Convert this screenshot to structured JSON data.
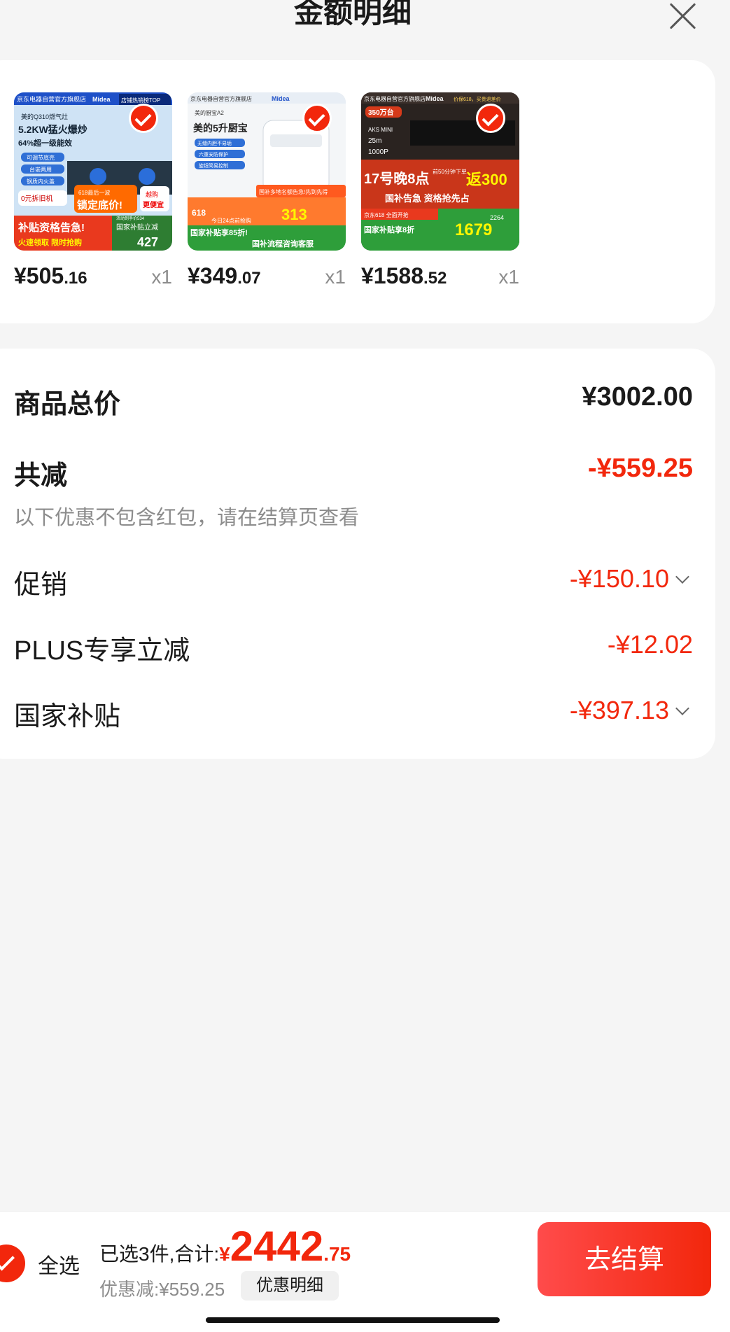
{
  "header": {
    "title": "金额明细",
    "close_icon": "close-icon"
  },
  "products": [
    {
      "price_int": "¥505",
      "price_dec": ".16",
      "qty": "x1",
      "image_texts": [
        "京东电器自营官方旗舰店",
        "Midea",
        "店铺热销榜TOP",
        "美的Q310燃气灶",
        "5.2KW猛火爆炒",
        "64%超一级能效",
        "可调节底壳",
        "台嵌两用",
        "钢质内火盖",
        "0元拆旧机",
        "618最后一波",
        "锁定底价!",
        "越购",
        "更便宜",
        "补贴资格告急!",
        "火速领取 限时抢购",
        "国家补贴立减",
        "427",
        "活动到手价534"
      ]
    },
    {
      "price_int": "¥349",
      "price_dec": ".07",
      "qty": "x1",
      "image_texts": [
        "京东电器自营官方旗舰店",
        "Midea",
        "美的厨宝A2",
        "美的5升厨宝",
        "无缝内胆不易垢",
        "六重安防保护",
        "旋钮简易控制",
        "国补多地名额告急!先到先得",
        "618",
        "今日24点前抢购",
        "313",
        "国家补贴享85折!",
        "国补流程咨询客服"
      ]
    },
    {
      "price_int": "¥1588",
      "price_dec": ".52",
      "qty": "x1",
      "image_texts": [
        "京东电器自营官方旗舰店",
        "Midea",
        "价保618，买贵退差价",
        "350万台",
        "AKS MINI",
        "25m",
        "1000P",
        "17号晚8点",
        "前50分钟下单",
        "返300",
        "国补告急 资格抢先占",
        "京东618 全面开抢",
        "国家补贴享8折",
        "1679",
        "2264"
      ]
    }
  ],
  "amount": {
    "total_label": "商品总价",
    "total_value": "¥3002.00",
    "reduce_label": "共减",
    "reduce_value": "-¥559.25",
    "note": "以下优惠不包含红包，请在结算页查看",
    "rows": [
      {
        "label": "促销",
        "value": "-¥150.10",
        "expandable": true
      },
      {
        "label": "PLUS专享立减",
        "value": "-¥12.02",
        "expandable": false
      },
      {
        "label": "国家补贴",
        "value": "-¥397.13",
        "expandable": true
      }
    ]
  },
  "bottom": {
    "select_all": "全选",
    "summary_prefix": "已选3件,合计:",
    "total_symbol": "¥",
    "total_int": "2442",
    "total_dec": ".75",
    "discount_text": "优惠减:¥559.25",
    "discount_detail_button": "优惠明细",
    "checkout_button": "去结算"
  },
  "colors": {
    "accent_red": "#f2270c",
    "page_bg": "#f5f5f5",
    "card_bg": "#ffffff"
  }
}
